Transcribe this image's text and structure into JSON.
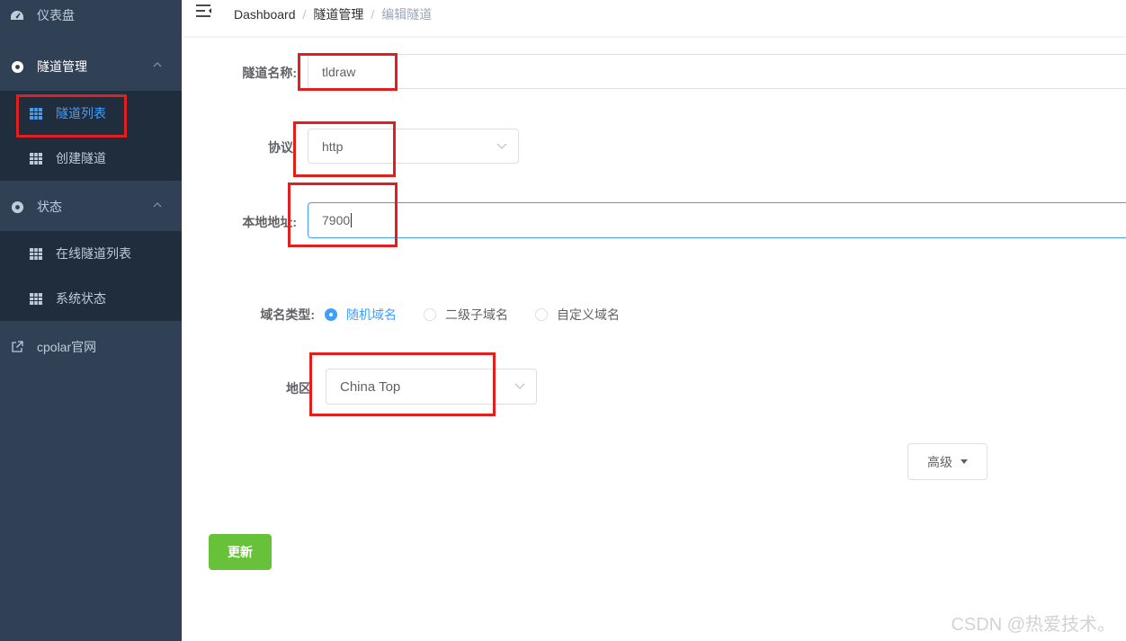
{
  "sidebar": {
    "dashboard": "仪表盘",
    "tunnel_mgmt": "隧道管理",
    "tunnel_list": "隧道列表",
    "create_tunnel": "创建隧道",
    "status": "状态",
    "online_list": "在线隧道列表",
    "system_status": "系统状态",
    "cpolar_site": "cpolar官网"
  },
  "breadcrumb": {
    "home": "Dashboard",
    "section": "隧道管理",
    "current": "编辑隧道",
    "separator": "/"
  },
  "form": {
    "name_label": "隧道名称:",
    "name_value": "tldraw",
    "protocol_label": "协议",
    "protocol_value": "http",
    "local_addr_label": "本地地址:",
    "local_addr_value": "7900",
    "domain_type_label": "域名类型:",
    "domain_options": [
      "随机域名",
      "二级子域名",
      "自定义域名"
    ],
    "domain_selected": "随机域名",
    "region_label": "地区",
    "region_value": "China Top",
    "advanced_label": "高级",
    "submit_label": "更新"
  },
  "watermark": "CSDN @热爱技术。",
  "colors": {
    "sidebar_bg": "#304156",
    "submenu_bg": "#1f2d3d",
    "active": "#409eff",
    "success": "#67c23a",
    "highlight": "#e0201f"
  }
}
